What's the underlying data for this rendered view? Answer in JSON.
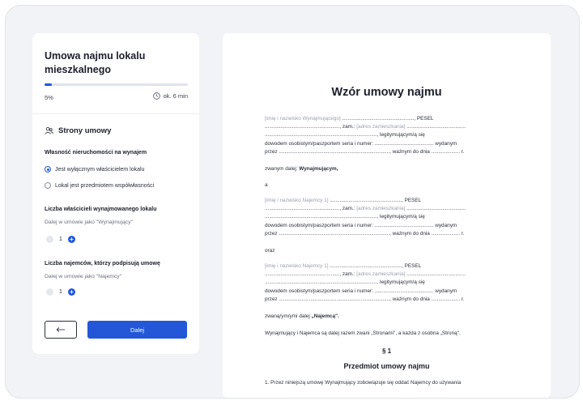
{
  "sidebar": {
    "title": "Umowa najmu lokalu mieszkalnego",
    "progress": {
      "percent_label": "5%",
      "fraction": 0.05,
      "time_label": "ok. 6 min"
    },
    "section": {
      "title": "Strony umowy",
      "icon": "people-icon"
    },
    "ownership": {
      "label": "Własność nieruchomości na wynajem",
      "options": [
        {
          "label": "Jest wyłącznym właścicielem lokalu",
          "checked": true
        },
        {
          "label": "Lokal jest przedmiotem współwłasności",
          "checked": false
        }
      ]
    },
    "owners": {
      "label": "Liczba właścicieli wynajmowanego lokalu",
      "sub": "Dalej w umowie jako \"Wynajmujący\"",
      "value": "1"
    },
    "tenants": {
      "label": "Liczba najemców, którzy podpisują umowę",
      "sub": "Dalej w umowie jako \"Najemcy\"",
      "value": "1"
    },
    "next_label": "Dalej",
    "accent": "#2357d8"
  },
  "document": {
    "title": "Wzór umowy najmu",
    "landlord": {
      "name_ph": "[imię i nazwisko Wynajmującego]",
      "line1_tail": " .................................................., PESEL",
      "line2_head": "...................................................., zam.: ",
      "addr_ph": "[adres zamieszkania]",
      "line2_tail": " .........................................",
      "line3": ".............................................................................., legitymującym/ą się",
      "line4": "dowodem osobistym/paszportem seria i numer: ......................................... wydanym",
      "line5": "przez ............................................................................., ważnym do dnia .................... r."
    },
    "landlord_called_prefix": "zwanym dalej: ",
    "landlord_called_bold": "Wynajmującym,",
    "and1": "a",
    "tenant": {
      "name_ph": "[imię i nazwisko Najemcy 1]",
      "line1_tail": " .................................................., PESEL",
      "line2_head": "...................................................., zam.: ",
      "addr_ph": "[adres zamieszkania]",
      "line2_tail": " .........................................",
      "line3": ".............................................................................., legitymującym/ą się",
      "line4": "dowodem osobistym/paszportem seria i numer: ......................................... wydanym",
      "line5": "przez ............................................................................., ważnym do dnia .................... r."
    },
    "and2": "oraz",
    "tenant2": {
      "name_ph": "[imię i nazwisko Najemcy 1]",
      "line1_tail": " .................................................., PESEL",
      "line2_head": "...................................................., zam.: ",
      "addr_ph": "[adres zamieszkania]",
      "line2_tail": " .........................................",
      "line3": ".............................................................................., legitymującym/ą się",
      "line4": "dowodem osobistym/paszportem seria i numer: ......................................... wydanym",
      "line5": "przez ............................................................................., ważnym do dnia .................... r."
    },
    "tenant_called_prefix": "zwaną/ym/ymi dalej ",
    "tenant_called_bold": "„Najemcą\".",
    "parties_sentence": "Wynajmujący i Najemca są dalej razem zwani „Stronami\", a każda z osobna „Stroną\".",
    "para_num": "§ 1",
    "para_title": "Przedmiot umowy najmu",
    "cut_line": "1.   Przez niniejszą umowę Wynajmujący zobowiązuje się oddać Najemcy do używania"
  }
}
